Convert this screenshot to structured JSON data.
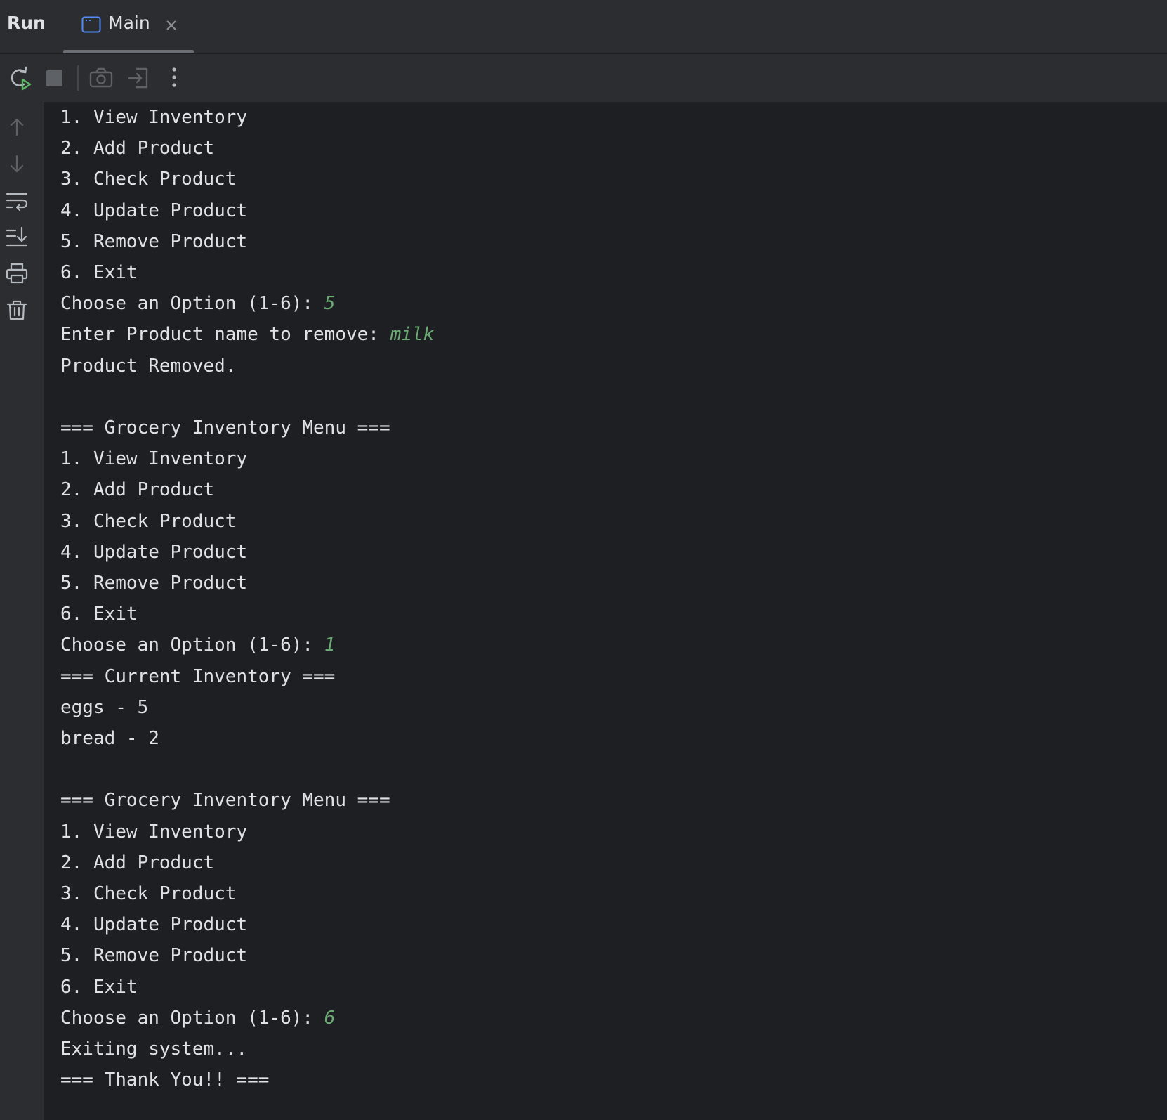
{
  "window": {
    "panel_title": "Run",
    "tab": {
      "label": "Main"
    }
  },
  "colors": {
    "background": "#1e1f22",
    "panel": "#2b2d30",
    "text": "#dfe1e5",
    "user_input": "#6aab73",
    "run_icon_green": "#5fb865",
    "tab_icon_blue": "#548af7"
  },
  "toolbar": {
    "icons": [
      "rerun-icon",
      "stop-icon",
      "camera-icon",
      "login-icon",
      "more-options-icon"
    ]
  },
  "gutter": {
    "icons": [
      "arrow-up-icon",
      "arrow-down-icon",
      "soft-wrap-icon",
      "scroll-to-end-icon",
      "print-icon",
      "trash-icon"
    ]
  },
  "console": {
    "lines": [
      {
        "text": "1. View Inventory"
      },
      {
        "text": "2. Add Product"
      },
      {
        "text": "3. Check Product"
      },
      {
        "text": "4. Update Product"
      },
      {
        "text": "5. Remove Product"
      },
      {
        "text": "6. Exit"
      },
      {
        "text": "Choose an Option (1-6): ",
        "input": "5"
      },
      {
        "text": "Enter Product name to remove: ",
        "input": "milk"
      },
      {
        "text": "Product Removed."
      },
      {
        "text": ""
      },
      {
        "text": "=== Grocery Inventory Menu ==="
      },
      {
        "text": "1. View Inventory"
      },
      {
        "text": "2. Add Product"
      },
      {
        "text": "3. Check Product"
      },
      {
        "text": "4. Update Product"
      },
      {
        "text": "5. Remove Product"
      },
      {
        "text": "6. Exit"
      },
      {
        "text": "Choose an Option (1-6): ",
        "input": "1"
      },
      {
        "text": "=== Current Inventory ==="
      },
      {
        "text": "eggs - 5"
      },
      {
        "text": "bread - 2"
      },
      {
        "text": ""
      },
      {
        "text": "=== Grocery Inventory Menu ==="
      },
      {
        "text": "1. View Inventory"
      },
      {
        "text": "2. Add Product"
      },
      {
        "text": "3. Check Product"
      },
      {
        "text": "4. Update Product"
      },
      {
        "text": "5. Remove Product"
      },
      {
        "text": "6. Exit"
      },
      {
        "text": "Choose an Option (1-6): ",
        "input": "6"
      },
      {
        "text": "Exiting system..."
      },
      {
        "text": "=== Thank You!! ==="
      }
    ]
  }
}
